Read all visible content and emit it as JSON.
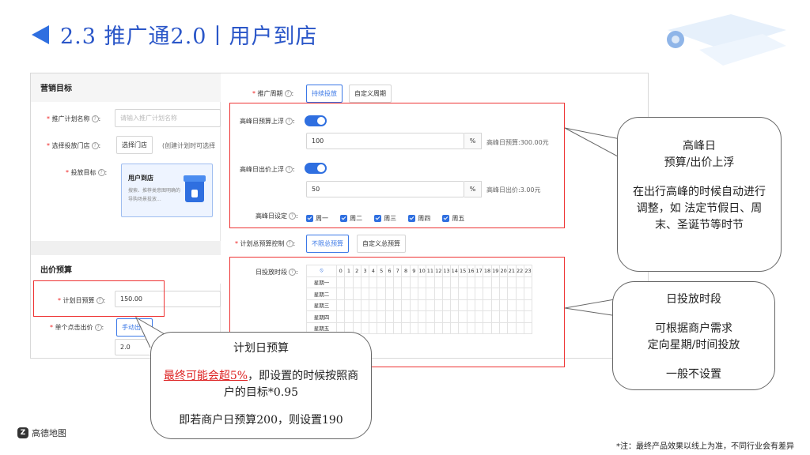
{
  "header": {
    "title": "2.3 推广通2.0丨用户到店"
  },
  "left": {
    "marketing_title": "营销目标",
    "plan_name_label": "推广计划名称",
    "plan_name_placeholder": "请输入推广计划名称",
    "store_label": "选择投放门店",
    "store_button": "选择门店",
    "store_note": "(创建计划时可选择",
    "goal_label": "投放目标",
    "goal_card_title": "用户到店",
    "goal_card_desc": "搜索、推荐类意图明确的导购场景投放...",
    "bid_title": "出价预算",
    "daily_budget_label": "计划日预算",
    "daily_budget_value": "150.00",
    "cpc_label": "单个点击出价",
    "cpc_button": "手动出价",
    "cpc_value": "2.0"
  },
  "right": {
    "period_label": "推广周期",
    "period_opt1": "持续投放",
    "period_opt2": "自定义周期",
    "peak_budget_label": "高峰日预算上浮",
    "peak_budget_value": "100",
    "peak_budget_unit": "%",
    "peak_budget_note": "高峰日预算:300.00元",
    "peak_bid_label": "高峰日出价上浮",
    "peak_bid_value": "50",
    "peak_bid_unit": "%",
    "peak_bid_note": "高峰日出价:3.00元",
    "peak_days_label": "高峰日设定",
    "peak_days": [
      "周一",
      "周二",
      "周三",
      "周四",
      "周五"
    ],
    "budget_ctrl_label": "计划总预算控制",
    "budget_ctrl_opt1": "不限总预算",
    "budget_ctrl_opt2": "自定义总预算",
    "schedule_label": "日投放时段",
    "hours": [
      "0",
      "1",
      "2",
      "3",
      "4",
      "5",
      "6",
      "7",
      "8",
      "9",
      "10",
      "11",
      "12",
      "13",
      "14",
      "15",
      "16",
      "17",
      "18",
      "19",
      "20",
      "21",
      "22",
      "23"
    ],
    "weekdays": [
      "星期一",
      "星期二",
      "星期三",
      "星期四",
      "星期五"
    ]
  },
  "callouts": {
    "peak": {
      "line1": "高峰日",
      "line2": "预算/出价上浮",
      "body": "在出行高峰的时候自动进行调整，如 法定节假日、周末、圣诞节等时节"
    },
    "schedule": {
      "line1": "日投放时段",
      "body1": "可根据商户需求",
      "body2": "定向星期/时间投放",
      "body3": "一般不设置"
    },
    "budget": {
      "title": "计划日预算",
      "red": "最终可能会超5%",
      "rest": "，即设置的时候按照商户的目标*0.95",
      "example": "即若商户日预算200，则设置190"
    }
  },
  "footer": {
    "logo_text": "高德地图",
    "note": "*注：最终产品效果以线上为准，不同行业会有差异"
  }
}
